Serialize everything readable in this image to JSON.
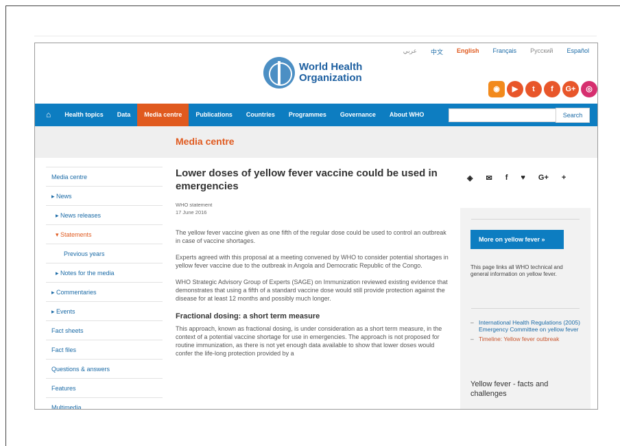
{
  "languages": [
    "عربي",
    "中文",
    "English",
    "Français",
    "Русский",
    "Español"
  ],
  "logo": {
    "line1": "World Health",
    "line2": "Organization"
  },
  "social_icons": [
    "rss-icon",
    "youtube-icon",
    "twitter-icon",
    "facebook-icon",
    "google-plus-icon",
    "instagram-icon"
  ],
  "nav": {
    "items": [
      "Health topics",
      "Data",
      "Media centre",
      "Publications",
      "Countries",
      "Programmes",
      "Governance",
      "About WHO"
    ],
    "active": "Media centre",
    "search_button": "Search"
  },
  "section_title": "Media centre",
  "sidebar": {
    "items": [
      {
        "label": "Media centre",
        "level": 1
      },
      {
        "label": "▸ News",
        "level": 1
      },
      {
        "label": "▸ News releases",
        "level": 2
      },
      {
        "label": "▾ Statements",
        "level": 2
      },
      {
        "label": "Previous years",
        "level": 3
      },
      {
        "label": "▸ Notes for the media",
        "level": 2
      },
      {
        "label": "▸ Commentaries",
        "level": 1
      },
      {
        "label": "▸ Events",
        "level": 1
      },
      {
        "label": "Fact sheets",
        "level": 1
      },
      {
        "label": "Fact files",
        "level": 1
      },
      {
        "label": "Questions & answers",
        "level": 1
      },
      {
        "label": "Features",
        "level": 1
      },
      {
        "label": "Multimedia",
        "level": 1
      }
    ]
  },
  "article": {
    "title": "Lower doses of yellow fever vaccine could be used in emergencies",
    "type": "WHO statement",
    "date": "17 June 2016",
    "paragraphs": [
      "The yellow fever vaccine given as one fifth of the regular dose could be used to control an outbreak in case of vaccine shortages.",
      "Experts agreed with this proposal at a meeting convened by WHO to consider potential shortages in yellow fever vaccine due to the outbreak in Angola and Democratic Republic of the Congo.",
      "WHO Strategic Advisory Group of Experts (SAGE) on Immunization reviewed existing evidence that demonstrates that using a fifth of a standard vaccine dose would still provide protection against the disease for at least 12 months and possibly much longer."
    ],
    "subheading": "Fractional dosing: a short term measure",
    "paragraph4": "This approach, known as fractional dosing, is under consideration as a short term measure, in the context of a potential vaccine shortage for use in emergencies. The approach is not proposed for routine immunization, as there is not yet enough data available to show that lower doses would confer the life-long protection provided by a"
  },
  "share_icons": [
    "feedback-icon",
    "email-icon",
    "facebook-icon",
    "twitter-icon",
    "google-plus-icon",
    "plus-icon"
  ],
  "right": {
    "button": "More on yellow fever »",
    "description": "This page links all WHO technical and general information on yellow fever.",
    "links": [
      "International Health Regulations (2005) Emergency Committee on yellow fever",
      "Timeline: Yellow fever outbreak"
    ],
    "subtitle": "Yellow fever - facts and challenges"
  }
}
